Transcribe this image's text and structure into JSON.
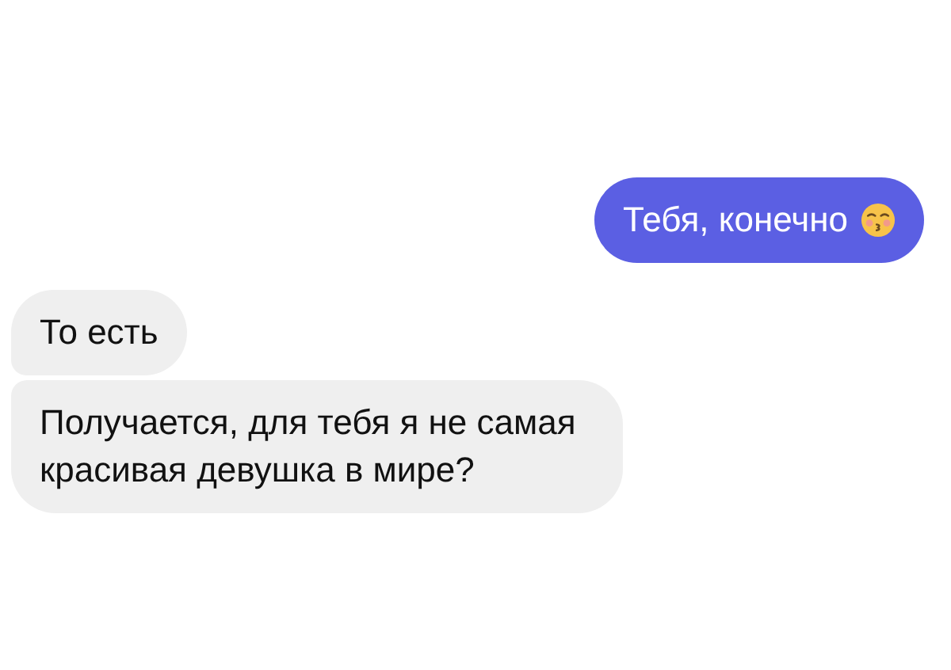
{
  "messages": [
    {
      "kind": "outgoing",
      "text": "Тебя, конечно",
      "emoji": true
    },
    {
      "kind": "incoming",
      "text": "То есть",
      "emoji": false
    },
    {
      "kind": "incoming",
      "text": "Получается, для тебя я не самая красивая девушка в мире?",
      "emoji": false
    }
  ]
}
